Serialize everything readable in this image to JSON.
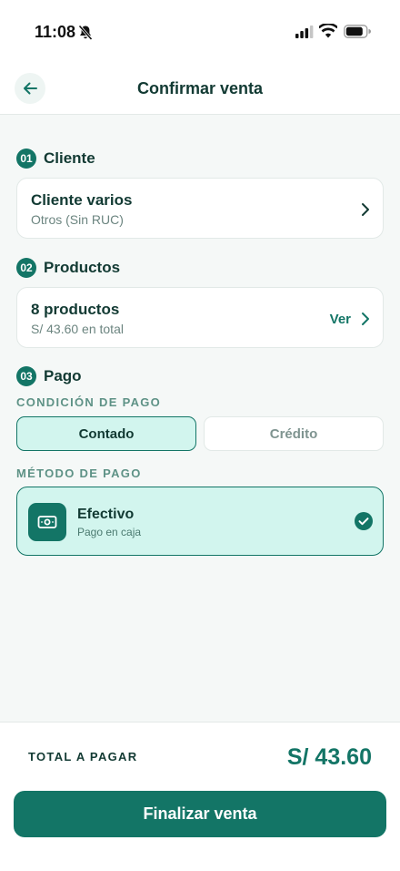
{
  "status_bar": {
    "time": "11:08"
  },
  "header": {
    "title": "Confirmar venta"
  },
  "client_section": {
    "step": "01",
    "title": "Cliente",
    "card_title": "Cliente varios",
    "card_subtitle": "Otros (Sin RUC)"
  },
  "products_section": {
    "step": "02",
    "title": "Productos",
    "card_title": "8 productos",
    "card_subtitle": "S/ 43.60 en total",
    "view_label": "Ver"
  },
  "payment_section": {
    "step": "03",
    "title": "Pago",
    "condition_label": "CONDICIÓN DE PAGO",
    "condition_options": [
      "Contado",
      "Crédito"
    ],
    "selected_condition": "Contado",
    "method_label": "MÉTODO DE PAGO",
    "method": {
      "title": "Efectivo",
      "subtitle": "Pago en caja",
      "icon": "cash-icon",
      "selected": true
    }
  },
  "footer": {
    "total_label": "TOTAL A PAGAR",
    "total_value": "S/ 43.60",
    "finalize_label": "Finalizar venta"
  },
  "colors": {
    "accent": "#137566",
    "accent_light": "#d2f5ee",
    "text": "#123a33",
    "background": "#f5f8f7"
  }
}
